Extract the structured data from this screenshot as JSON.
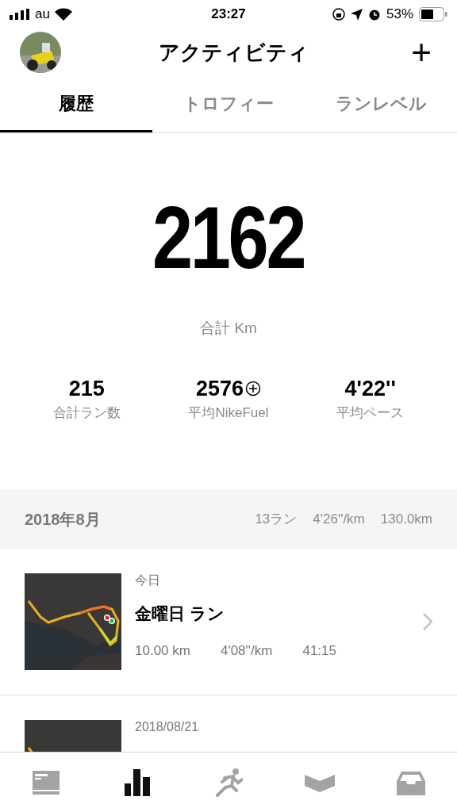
{
  "status_bar": {
    "carrier": "au",
    "time": "23:27",
    "battery": "53%"
  },
  "header": {
    "title": "アクティビティ",
    "add_symbol": "+"
  },
  "tabs": [
    {
      "label": "履歴",
      "selected": true
    },
    {
      "label": "トロフィー",
      "selected": false
    },
    {
      "label": "ランレベル",
      "selected": false
    }
  ],
  "summary": {
    "total": "2162",
    "total_label": "合計 Km",
    "stats": [
      {
        "value": "215",
        "label": "合計ラン数",
        "fuel": false
      },
      {
        "value": "2576",
        "label": "平均NikeFuel",
        "fuel": true
      },
      {
        "value": "4'22''",
        "label": "平均ペース",
        "fuel": false
      }
    ]
  },
  "month": {
    "title": "2018年8月",
    "runs": "13ラン",
    "pace": "4'26''/km",
    "distance": "130.0km"
  },
  "runs": [
    {
      "date": "今日",
      "title": "金曜日 ラン",
      "distance": "10.00 km",
      "pace": "4'08''/km",
      "time": "41:15"
    },
    {
      "date": "2018/08/21"
    }
  ],
  "tab_bar": [
    {
      "kind": "feed",
      "selected": false
    },
    {
      "kind": "activity",
      "selected": true
    },
    {
      "kind": "run",
      "selected": false
    },
    {
      "kind": "club",
      "selected": false
    },
    {
      "kind": "inbox",
      "selected": false
    }
  ]
}
